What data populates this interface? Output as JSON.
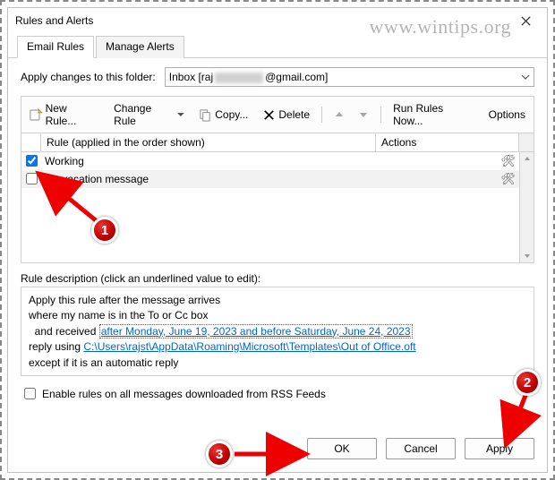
{
  "titlebar": {
    "title": "Rules and Alerts"
  },
  "watermark": "www.wintips.org",
  "tabs": {
    "email_rules": "Email Rules",
    "manage_alerts": "Manage Alerts"
  },
  "folder": {
    "label": "Apply changes to this folder:",
    "value_prefix": "Inbox [raj",
    "value_suffix": "@gmail.com]"
  },
  "toolbar": {
    "new_rule": "New Rule...",
    "change_rule": "Change Rule",
    "copy": "Copy...",
    "delete": "Delete",
    "run_rules": "Run Rules Now...",
    "options": "Options"
  },
  "grid": {
    "header_rule": "Rule (applied in the order shown)",
    "header_actions": "Actions",
    "rows": [
      {
        "checked": true,
        "name": "Working"
      },
      {
        "checked": false,
        "name": "On vacation message"
      }
    ]
  },
  "description": {
    "label": "Rule description (click an underlined value to edit):",
    "line1": "Apply this rule after the message arrives",
    "line2": "where my name is in the To or Cc box",
    "line3_prefix": "  and received ",
    "line3_link": "after Monday, June 19, 2023 and before Saturday, June 24, 2023",
    "line4_prefix": "reply using ",
    "line4_link": "C:\\Users\\rajst\\AppData\\Roaming\\Microsoft\\Templates\\Out of Office.oft",
    "line5": "except if it is an automatic reply"
  },
  "rss": {
    "label": "Enable rules on all messages downloaded from RSS Feeds"
  },
  "buttons": {
    "ok": "OK",
    "cancel": "Cancel",
    "apply": "Apply"
  }
}
